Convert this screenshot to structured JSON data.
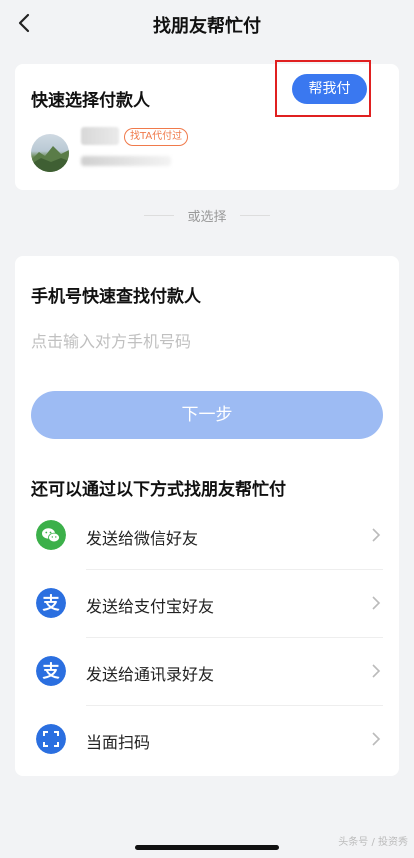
{
  "header": {
    "title": "找朋友帮忙付"
  },
  "quick_select": {
    "heading": "快速选择付款人",
    "contact_tag": "找TA代付过",
    "help_button": "帮我付"
  },
  "divider": {
    "text": "或选择"
  },
  "phone_search": {
    "heading": "手机号快速查找付款人",
    "placeholder": "点击输入对方手机号码",
    "next_button": "下一步"
  },
  "other_methods": {
    "heading": "还可以通过以下方式找朋友帮忙付",
    "items": [
      {
        "label": "发送给微信好友",
        "icon": "wechat-icon",
        "color": "#3cb04a"
      },
      {
        "label": "发送给支付宝好友",
        "icon": "alipay-icon",
        "color": "#2b6fe0"
      },
      {
        "label": "发送给通讯录好友",
        "icon": "alipay-icon",
        "color": "#2b6fe0"
      },
      {
        "label": "当面扫码",
        "icon": "scan-icon",
        "color": "#2b6fe0"
      }
    ]
  },
  "watermark": "头条号 / 投资秀"
}
